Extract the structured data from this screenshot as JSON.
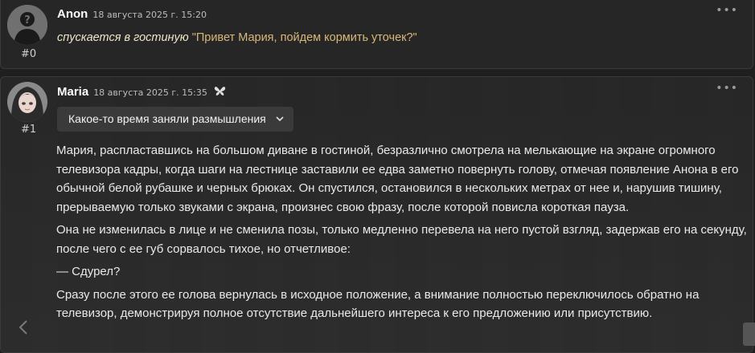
{
  "messages": [
    {
      "author": "Anon",
      "time": "18 августа 2025 г. 15:20",
      "index": "#0",
      "action": "спускается в гостиную",
      "quote": "\"Привет Мария, пойдем кормить уточек?\"",
      "menu": "•••"
    },
    {
      "author": "Maria",
      "time": "18 августа 2025 г. 15:35",
      "index": "#1",
      "dropdown": "Какое-то время заняли размышления",
      "menu": "•••",
      "paragraphs": [
        "Мария, распластавшись на большом диване в гостиной, безразлично смотрела на мелькающие на экране огромного телевизора кадры, когда шаги на лестнице заставили ее едва заметно повернуть голову, отмечая появление Анона в его обычной белой рубашке и черных брюках. Он спустился, остановился в нескольких метрах от нее и, нарушив тишину, прерываемую только звуками с экрана, произнес свою фразу, после которой повисла короткая пауза.",
        "Она не изменилась в лице и не сменила позы, только медленно перевела на него пустой взгляд, задержав его на секунду, после чего с ее губ сорвалось тихое, но отчетливое:",
        "— Сдурел?",
        "Сразу после этого ее голова вернулась в исходное положение, а внимание полностью переключилось обратно на телевизор, демонстрируя полное отсутствие дальнейшего интереса к его предложению или присутствию."
      ]
    }
  ]
}
